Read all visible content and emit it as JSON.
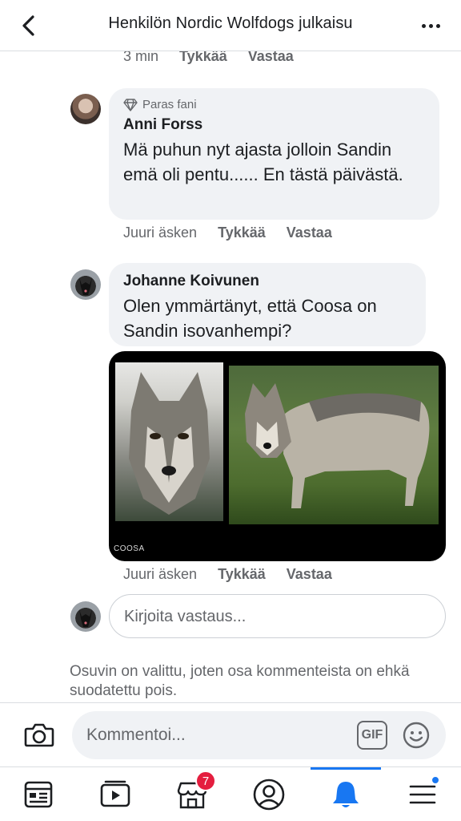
{
  "header": {
    "title": "Henkilön Nordic Wolfdogs julkaisu"
  },
  "top_row": {
    "time": "3 min",
    "like": "Tykkää",
    "reply": "Vastaa"
  },
  "comments": [
    {
      "badge": "Paras fani",
      "author": "Anni Forss",
      "text": "Mä puhun nyt ajasta jolloin Sandin emä oli pentu...... En tästä päivästä.",
      "time": "Juuri äsken",
      "like": "Tykkää",
      "reply": "Vastaa"
    },
    {
      "author": "Johanne Koivunen",
      "text": "Olen ymmärtänyt, että Coosa on Sandin isovanhempi?",
      "photo_caption": "COOSA",
      "time": "Juuri äsken",
      "like": "Tykkää",
      "reply": "Vastaa"
    }
  ],
  "reply_input": {
    "placeholder": "Kirjoita vastaus..."
  },
  "notice": "Osuvin on valittu, joten osa kommenteista on ehkä suodatettu pois.",
  "composer": {
    "placeholder": "Kommentoi...",
    "gif_label": "GIF"
  },
  "tabbar": {
    "marketplace_badge": "7",
    "active_tab": "notifications"
  },
  "colors": {
    "accent": "#1877f2",
    "badge": "#e41e3f",
    "bubble": "#f0f2f5",
    "secondary_text": "#65676b"
  }
}
